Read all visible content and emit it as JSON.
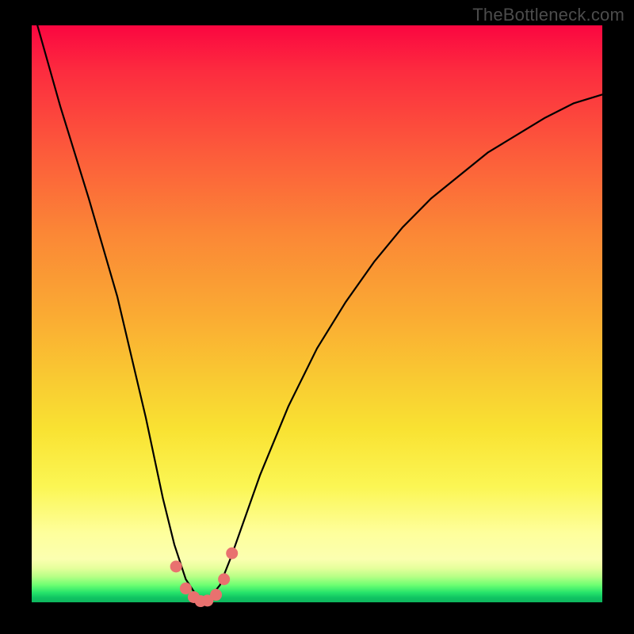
{
  "watermark": "TheBottleneck.com",
  "chart_data": {
    "type": "line",
    "title": "",
    "xlabel": "",
    "ylabel": "",
    "x_range": [
      0,
      100
    ],
    "y_range": [
      0,
      100
    ],
    "note": "V-shaped bottleneck curve; minimum ≈ 0 near x ≈ 30; values estimated from plot pixels (no axis labels present).",
    "series": [
      {
        "name": "bottleneck-curve",
        "x": [
          1,
          5,
          10,
          15,
          20,
          23,
          25,
          27,
          29,
          30,
          31,
          33,
          35,
          40,
          45,
          50,
          55,
          60,
          65,
          70,
          75,
          80,
          85,
          90,
          95,
          100
        ],
        "y": [
          100,
          86,
          70,
          53,
          32,
          18,
          10,
          4,
          1,
          0,
          0.5,
          3,
          8,
          22,
          34,
          44,
          52,
          59,
          65,
          70,
          74,
          78,
          81,
          84,
          86.5,
          88
        ]
      }
    ],
    "markers": {
      "name": "min-cluster",
      "description": "small salmon dots clustered near the curve minimum",
      "points": [
        {
          "x": 25.3,
          "y": 6.2
        },
        {
          "x": 27.0,
          "y": 2.4
        },
        {
          "x": 28.4,
          "y": 0.9
        },
        {
          "x": 29.6,
          "y": 0.2
        },
        {
          "x": 30.8,
          "y": 0.3
        },
        {
          "x": 32.3,
          "y": 1.3
        },
        {
          "x": 33.7,
          "y": 4.0
        },
        {
          "x": 35.1,
          "y": 8.5
        }
      ]
    },
    "background_gradient": {
      "top": "#fb0640",
      "mid_upper": "#fb8736",
      "mid": "#f9cc32",
      "mid_lower": "#feff9c",
      "bottom": "#0eb75e"
    }
  }
}
